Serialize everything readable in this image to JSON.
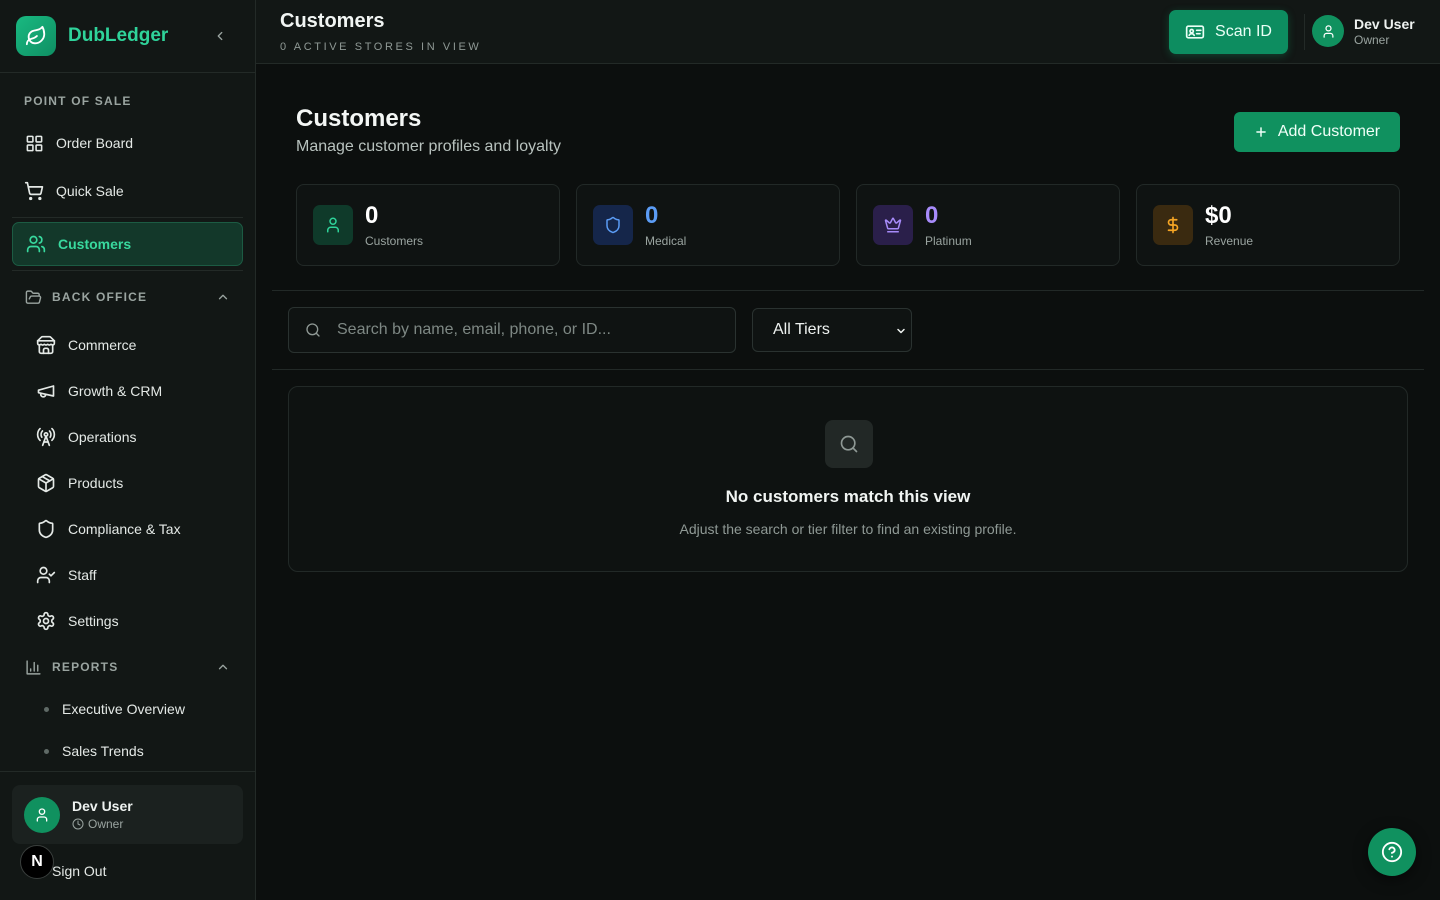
{
  "sidebar": {
    "brand": "DubLedger",
    "pos_section": "POINT OF SALE",
    "pos_items": [
      {
        "label": "Order Board",
        "icon": "grid-icon"
      },
      {
        "label": "Quick Sale",
        "icon": "cart-icon"
      },
      {
        "label": "Customers",
        "icon": "users-icon",
        "active": true
      }
    ],
    "back_office": {
      "label": "BACK OFFICE",
      "items": [
        {
          "label": "Commerce",
          "icon": "store-icon"
        },
        {
          "label": "Growth & CRM",
          "icon": "megaphone-icon"
        },
        {
          "label": "Operations",
          "icon": "radio-tower-icon"
        },
        {
          "label": "Products",
          "icon": "package-icon"
        },
        {
          "label": "Compliance & Tax",
          "icon": "shield-icon"
        },
        {
          "label": "Staff",
          "icon": "user-check-icon"
        },
        {
          "label": "Settings",
          "icon": "gear-icon"
        }
      ]
    },
    "reports": {
      "label": "REPORTS",
      "items": [
        {
          "label": "Executive Overview"
        },
        {
          "label": "Sales Trends"
        }
      ]
    },
    "user": {
      "name": "Dev User",
      "role": "Owner"
    },
    "sign_out": "Sign Out",
    "dev_badge": "N"
  },
  "header": {
    "title": "Customers",
    "subtitle": "0 ACTIVE STORES IN VIEW",
    "scan_label": "Scan ID",
    "user": {
      "name": "Dev User",
      "role": "Owner"
    }
  },
  "main": {
    "title": "Customers",
    "subtitle": "Manage customer profiles and loyalty",
    "add_label": "Add Customer",
    "stats": [
      {
        "value": "0",
        "label": "Customers",
        "color": "#ffffff",
        "accent": "#2fd39a",
        "bg": "#0f3a2a"
      },
      {
        "value": "0",
        "label": "Medical",
        "color": "#5b9cf5",
        "accent": "#5b9cf5",
        "bg": "#15264a"
      },
      {
        "value": "0",
        "label": "Platinum",
        "color": "#a78bfa",
        "accent": "#a78bfa",
        "bg": "#2a1f4a"
      },
      {
        "value": "$0",
        "label": "Revenue",
        "color": "#ffffff",
        "accent": "#f5a524",
        "bg": "#3a2a10"
      }
    ],
    "search_placeholder": "Search by name, email, phone, or ID...",
    "search_value": "",
    "tier_selected": "All Tiers",
    "empty": {
      "title": "No customers match this view",
      "subtitle": "Adjust the search or tier filter to find an existing profile."
    }
  },
  "colors": {
    "accent": "#10915f",
    "brand_text": "#2fd39a",
    "background": "#0c0f0e"
  }
}
